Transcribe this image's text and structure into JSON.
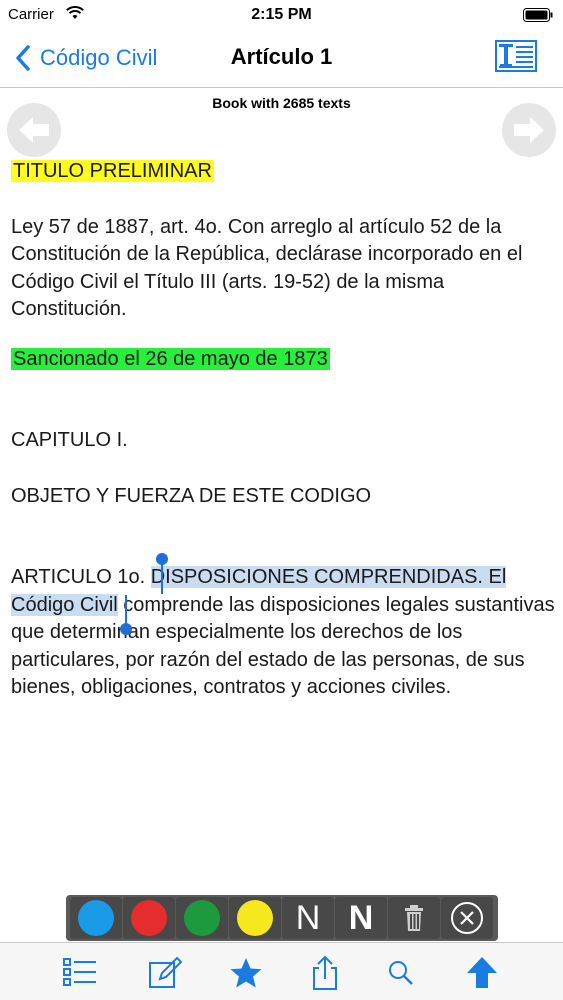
{
  "status": {
    "carrier": "Carrier",
    "time": "2:15 PM"
  },
  "nav": {
    "back_label": "Código Civil",
    "title": "Artículo 1"
  },
  "book_caption": "Book with 2685 texts",
  "article": {
    "title": "TITULO PRELIMINAR",
    "ley": "Ley 57 de 1887, art. 4o. Con arreglo al artículo 52 de la Constitución de la República, declárase incorporado en el Código Civil el Título III (arts. 19-52) de la misma Constitución.",
    "sancionado": "Sancionado el 26 de mayo de 1873",
    "capitulo": "CAPITULO I.",
    "objeto": "OBJETO Y FUERZA DE ESTE CODIGO",
    "articulo_prefix": "ARTICULO 1o. ",
    "articulo_selected": "DISPOSICIONES COMPRENDIDAS. El Código Civil",
    "articulo_rest": " comprende las disposiciones legales sustantivas que determinan especialmente los derechos de los particulares, por razón del estado de las personas, de sus bienes, obligaciones, contratos y acciones civiles."
  },
  "highlighter": {
    "colors": [
      "#1a9be8",
      "#e52d2d",
      "#1e9a3e",
      "#f5e81c"
    ],
    "note_letter": "N",
    "note_bold_letter": "N"
  },
  "tabs": [
    "list-icon",
    "edit-icon",
    "star-icon",
    "share-icon",
    "search-icon",
    "up-arrow-icon"
  ],
  "colors": {
    "accent": "#1a7ce0",
    "title_highlight": "#fffb1f",
    "sanction_highlight": "#28f03a",
    "selection": "#c9dcf2"
  }
}
